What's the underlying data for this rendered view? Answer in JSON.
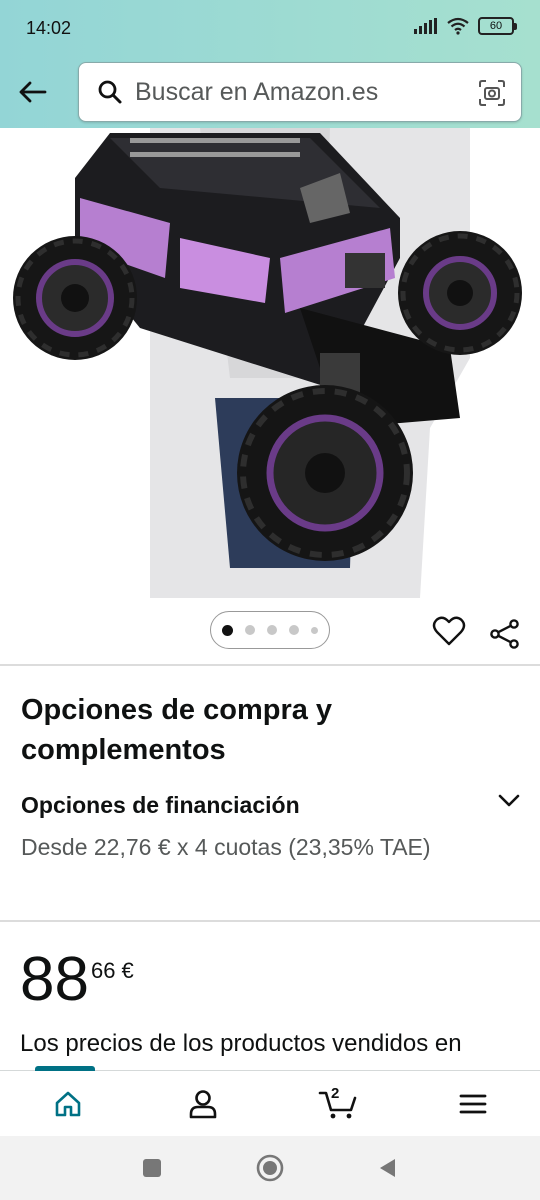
{
  "status_bar": {
    "time": "14:02",
    "battery": "60"
  },
  "header": {
    "search_placeholder": "Buscar en Amazon.es"
  },
  "product": {
    "carousel": {
      "count": 5,
      "active": 0
    },
    "section_title": "Opciones de compra y complementos",
    "financing_title": "Opciones de financiación",
    "financing_text": "Desde 22,76 € x 4 cuotas (23,35% TAE)",
    "price_whole": "88",
    "price_fraction": "66 €",
    "price_note": "Los precios de los productos vendidos en"
  },
  "bottom_nav": {
    "items": [
      "home-icon",
      "account-icon",
      "cart-icon",
      "menu-icon"
    ],
    "cart_count": "2",
    "accent_color": "#007185"
  },
  "colors": {
    "header_bg": "#9fdbd3",
    "accent": "#007185"
  }
}
